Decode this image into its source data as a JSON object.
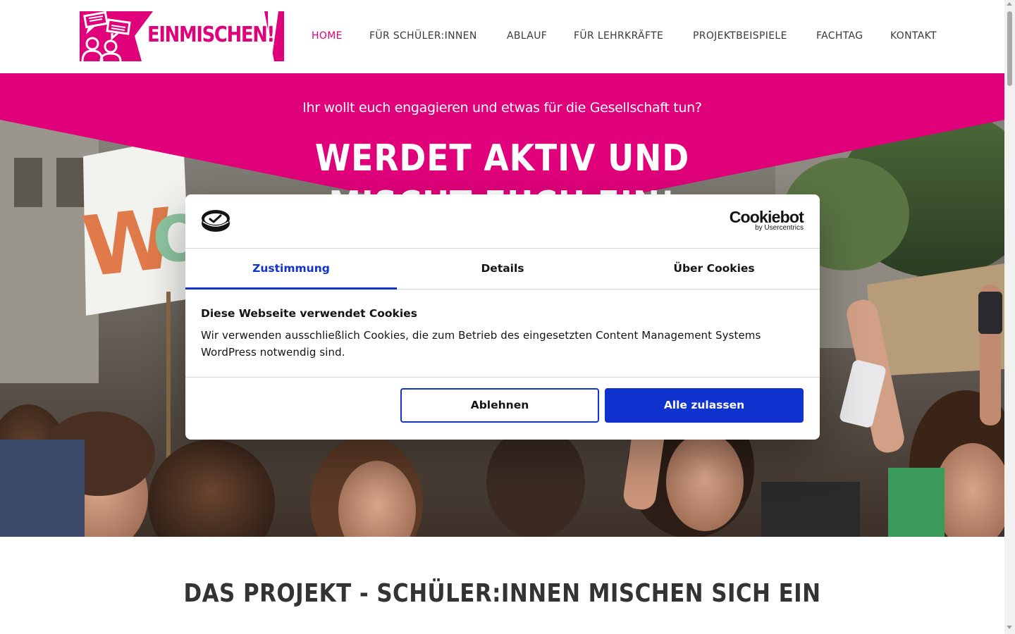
{
  "header": {
    "logo_text": "EINMISCHEN!",
    "nav": [
      {
        "label": "HOME",
        "active": true
      },
      {
        "label": "FÜR SCHÜLER:INNEN",
        "active": false
      },
      {
        "label": "ABLAUF",
        "active": false
      },
      {
        "label": "FÜR LEHRKRÄFTE",
        "active": false
      },
      {
        "label": "PROJEKTBEISPIELE",
        "active": false
      },
      {
        "label": "FACHTAG",
        "active": false
      },
      {
        "label": "KONTAKT",
        "active": false
      }
    ]
  },
  "hero": {
    "subtitle": "Ihr wollt euch engagieren und etwas für die Gesellschaft tun?",
    "title_line1": "WERDET AKTIV UND",
    "title_line2": "MISCHT EUCH EIN!"
  },
  "section": {
    "title": "DAS PROJEKT - SCHÜLER:INNEN MISCHEN SICH EIN"
  },
  "cookie_dialog": {
    "brand": "Cookiebot",
    "brand_sub": "by Usercentrics",
    "tabs": [
      {
        "label": "Zustimmung",
        "active": true
      },
      {
        "label": "Details",
        "active": false
      },
      {
        "label": "Über Cookies",
        "active": false
      }
    ],
    "heading": "Diese Webseite verwendet Cookies",
    "text": "Wir verwenden ausschließlich Cookies, die zum Betrieb des eingesetzten Content Management Systems WordPress notwendig sind.",
    "decline_label": "Ablehnen",
    "accept_label": "Alle zulassen"
  },
  "colors": {
    "brand_magenta": "#e0007a",
    "cookie_blue": "#1032cf",
    "text_dark": "#333333"
  }
}
